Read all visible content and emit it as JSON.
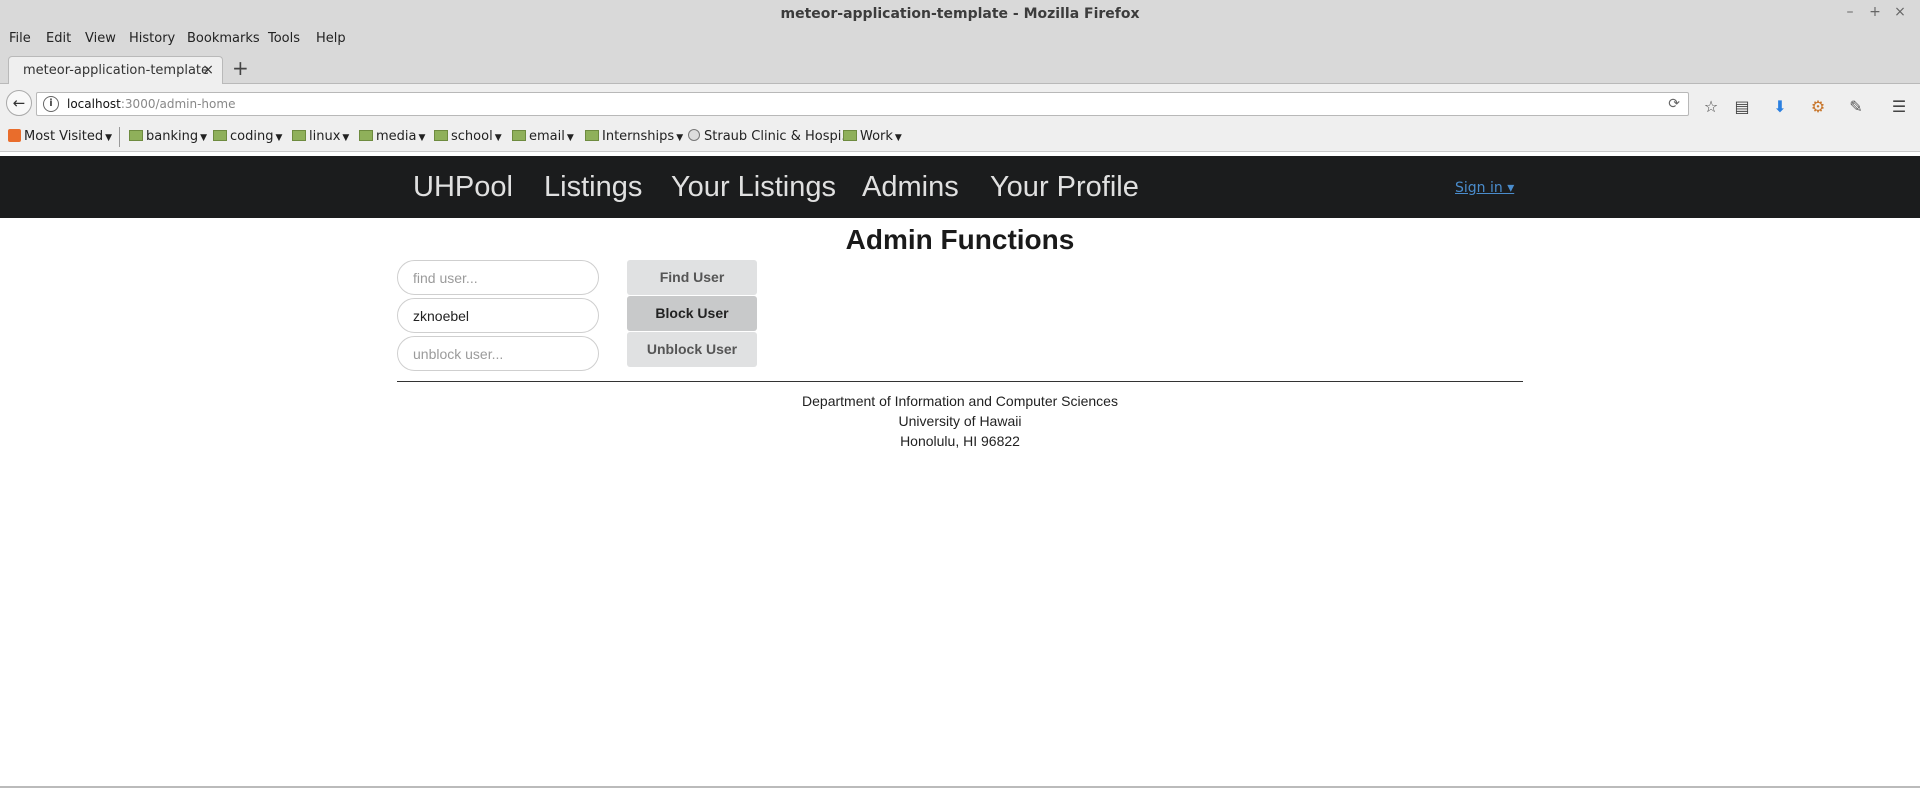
{
  "window": {
    "title": "meteor-application-template - Mozilla Firefox",
    "controls": [
      "–",
      "+",
      "×"
    ]
  },
  "menu": [
    "File",
    "Edit",
    "View",
    "History",
    "Bookmarks",
    "Tools",
    "Help"
  ],
  "tab": {
    "label": "meteor-application-template",
    "close": "×"
  },
  "newtab": "+",
  "urlbar": {
    "host": "localhost",
    "path": ":3000/admin-home"
  },
  "bookmarks": [
    {
      "label": "Most Visited",
      "type": "most-visited"
    },
    {
      "label": "banking",
      "type": "folder"
    },
    {
      "label": "coding",
      "type": "folder"
    },
    {
      "label": "linux",
      "type": "folder"
    },
    {
      "label": "media",
      "type": "folder"
    },
    {
      "label": "school",
      "type": "folder"
    },
    {
      "label": "email",
      "type": "folder"
    },
    {
      "label": "Internships",
      "type": "folder"
    },
    {
      "label": "Straub Clinic & Hospi...",
      "type": "link"
    },
    {
      "label": "Work",
      "type": "folder"
    }
  ],
  "app_nav": {
    "brand": "UHPool",
    "links": [
      "Listings",
      "Your Listings",
      "Admins",
      "Your Profile"
    ],
    "signin": "Sign in ▾"
  },
  "admin": {
    "title": "Admin Functions",
    "find_placeholder": "find user...",
    "block_value": "zknoebel",
    "unblock_placeholder": "unblock user...",
    "find_button": "Find User",
    "block_button": "Block User",
    "unblock_button": "Unblock User"
  },
  "footer": {
    "line1": "Department of Information and Computer Sciences",
    "line2": "University of Hawaii",
    "line3": "Honolulu, HI 96822"
  },
  "colors": {
    "navbar_bg": "#1b1c1d",
    "signin_link": "#4a8ccc",
    "button_bg": "#e0e1e2",
    "button_active_bg": "#c8c9ca"
  }
}
